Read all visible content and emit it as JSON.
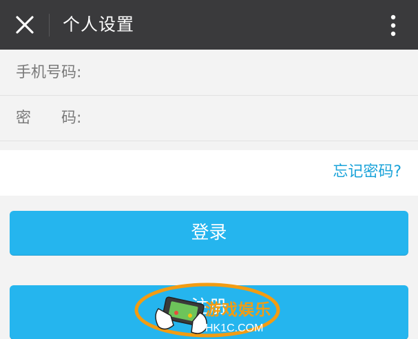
{
  "header": {
    "title": "个人设置",
    "close_icon": "close-icon",
    "more_icon": "more-vertical-icon"
  },
  "form": {
    "phone_label": "手机号码:",
    "phone_value": "",
    "password_label": "密　　码:",
    "password_value": ""
  },
  "forgot_password": "忘记密码?",
  "buttons": {
    "login": "登录",
    "register": "注册"
  },
  "watermark": {
    "text_cn": "游戏娱乐",
    "text_en": "HK1C.COM",
    "icon": "gamepad-hands-icon"
  },
  "colors": {
    "header_bg": "#3a3a3c",
    "accent": "#25b5ee",
    "link": "#1aa3d9",
    "watermark_orange": "#f39c12"
  }
}
